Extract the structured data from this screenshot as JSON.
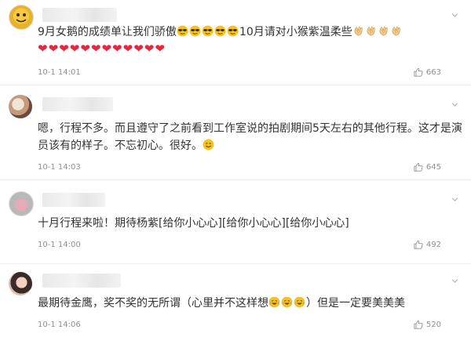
{
  "comments": [
    {
      "text_a": "9月女鹅的成绩单让我们骄傲",
      "text_b": "10月请对小猴紫温柔些",
      "time": "10-1 14:01",
      "likes": "663",
      "cool_emoji_count": 5,
      "clap_emoji_count": 4,
      "heart_emoji_count": 12
    },
    {
      "text": "嗯，行程不多。而且遵守了之前看到工作室说的拍剧期间5天左右的其他行程。这才是演员该有的样子。不忘初心。很好。",
      "time": "10-1 14:03",
      "likes": "645",
      "smile_emoji_count": 1
    },
    {
      "text": "十月行程来啦！期待杨紫[给你小心心][给你小心心][给你小心心]",
      "time": "10-1 14:00",
      "likes": "492"
    },
    {
      "text_a": "最期待金鹰，奖不奖的无所谓（心里并不这样想",
      "text_b": "）但是一定要美美美",
      "time": "10-1 14:06",
      "likes": "520",
      "cry_emoji_count": 3
    }
  ],
  "icons": {
    "like": "thumbs-up-icon",
    "more": "chevron-down-icon",
    "cool": "sunglasses-emoji-icon",
    "clap": "clapping-hands-emoji-icon",
    "heart": "red-heart-emoji-icon",
    "smile": "smile-emoji-icon",
    "cry": "laugh-cry-emoji-icon"
  },
  "colors": {
    "text": "#333333",
    "meta": "#8f8f8f",
    "heart": "#e4283d",
    "emoji": "#f6c21c"
  }
}
